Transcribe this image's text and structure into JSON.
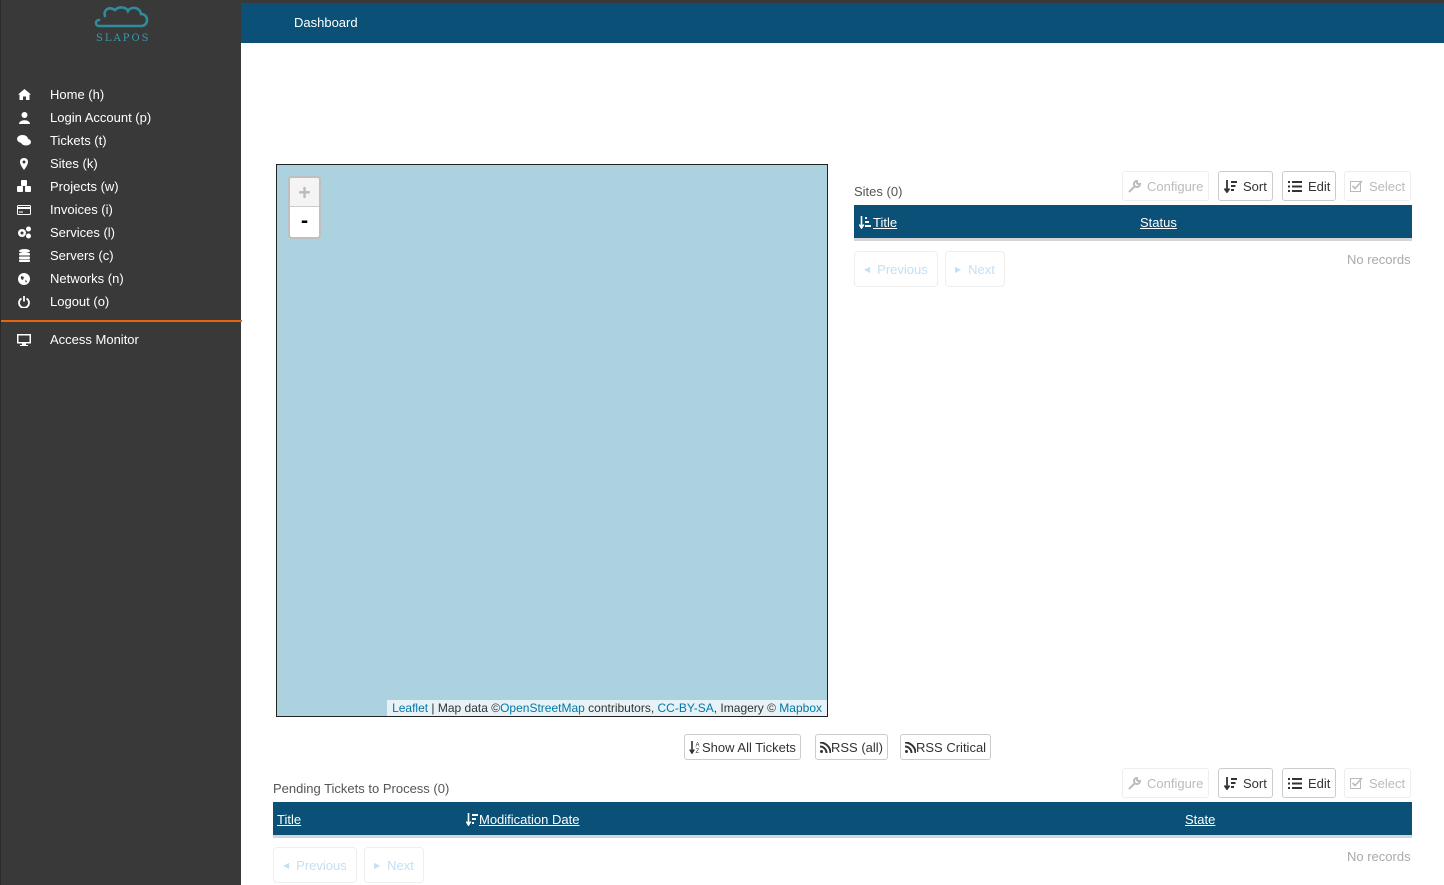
{
  "app": {
    "logo_text": "SLAPOS",
    "page_title": "Dashboard"
  },
  "sidebar": {
    "items": [
      {
        "label": "Home (h)",
        "icon": "home-icon"
      },
      {
        "label": "Login Account (p)",
        "icon": "user-icon"
      },
      {
        "label": "Tickets (t)",
        "icon": "comments-icon"
      },
      {
        "label": "Sites (k)",
        "icon": "map-marker-icon"
      },
      {
        "label": "Projects (w)",
        "icon": "cubes-icon"
      },
      {
        "label": "Invoices (i)",
        "icon": "credit-card-icon"
      },
      {
        "label": "Services (l)",
        "icon": "cogs-icon"
      },
      {
        "label": "Servers (c)",
        "icon": "database-icon"
      },
      {
        "label": "Networks (n)",
        "icon": "globe-icon"
      },
      {
        "label": "Logout (o)",
        "icon": "power-icon"
      }
    ],
    "secondary": [
      {
        "label": "Access Monitor",
        "icon": "desktop-icon"
      }
    ],
    "separator_color": "#e8650a"
  },
  "map": {
    "zoom_in": "+",
    "zoom_out": "-",
    "attribution": {
      "leaflet": "Leaflet",
      "sep1": " | Map data ©",
      "osm": "OpenStreetMap",
      "contributors": " contributors, ",
      "license": "CC-BY-SA",
      "imagery": ", Imagery © ",
      "mapbox": "Mapbox"
    }
  },
  "sites": {
    "title": "Sites (0)",
    "buttons": {
      "configure": "Configure",
      "sort": "Sort",
      "edit": "Edit",
      "select": "Select"
    },
    "columns": [
      "Title",
      "Status"
    ],
    "pager": {
      "previous": "Previous",
      "next": "Next"
    },
    "empty": "No records"
  },
  "ticket_actions": {
    "show_all": "Show All Tickets",
    "rss_all": "RSS (all)",
    "rss_critical": "RSS Critical"
  },
  "tickets": {
    "title": "Pending Tickets to Process (0)",
    "buttons": {
      "configure": "Configure",
      "sort": "Sort",
      "edit": "Edit",
      "select": "Select"
    },
    "columns": [
      "Title",
      "Modification Date",
      "State"
    ],
    "pager": {
      "previous": "Previous",
      "next": "Next"
    },
    "empty": "No records"
  },
  "colors": {
    "header": "#0b5076",
    "sidebar": "#393939",
    "map_water": "#abd2de",
    "accent": "#e8650a",
    "link": "#0078a8"
  }
}
